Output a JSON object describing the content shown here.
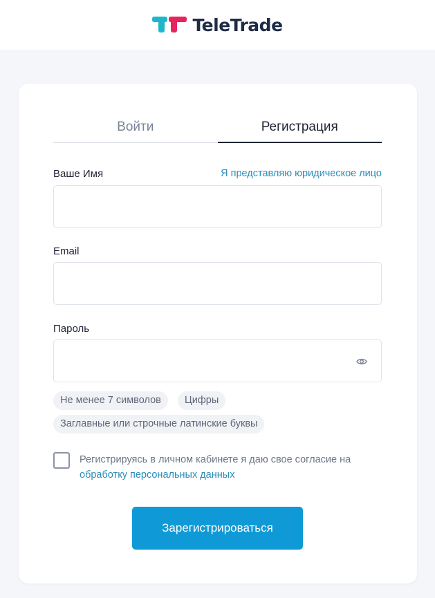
{
  "brand": {
    "name": "TeleTrade"
  },
  "colors": {
    "accent": "#0f9ad7",
    "link": "#2a8db8",
    "logo_teal": "#1fb6cb",
    "logo_pink": "#e6245e"
  },
  "tabs": [
    {
      "label": "Войти",
      "active": false
    },
    {
      "label": "Регистрация",
      "active": true
    }
  ],
  "form": {
    "name_label": "Ваше Имя",
    "legal_entity_link": "Я представляю юридическое лицо",
    "name_value": "",
    "email_label": "Email",
    "email_value": "",
    "password_label": "Пароль",
    "password_value": "",
    "password_icon": "eye-icon"
  },
  "password_rules": [
    "Не менее 7 символов",
    "Цифры",
    "Заглавные или строчные латинские буквы"
  ],
  "consent": {
    "checked": false,
    "text": "Регистрируясь в личном кабинете я даю свое согласие на ",
    "link": "обработку персональных данных"
  },
  "submit_label": "Зарегистрироваться"
}
